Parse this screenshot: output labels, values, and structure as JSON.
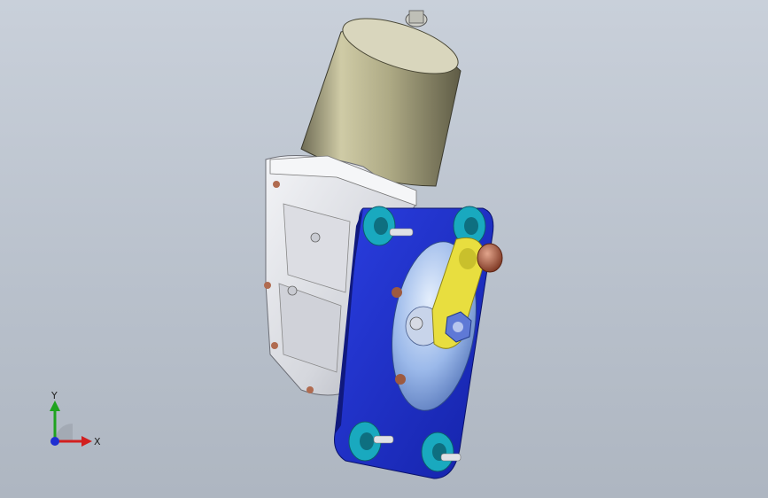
{
  "viewport": {
    "model": "motor-gearbox-assembly",
    "colors": {
      "background_top": "#c9d0da",
      "background_bottom": "#aeb6c1",
      "motor_can": "#b9b58f",
      "housing": "#e7e8ec",
      "mount_plate": "#1b2ec8",
      "disc": "#8fb0e6",
      "bushing": "#19a9bf",
      "link": "#e8de3f",
      "nut": "#b05a3a"
    }
  },
  "triad": {
    "y_label": "Y",
    "x_label": "X",
    "icons": [
      "y-axis-arrow",
      "x-axis-arrow",
      "z-axis-dot"
    ]
  }
}
